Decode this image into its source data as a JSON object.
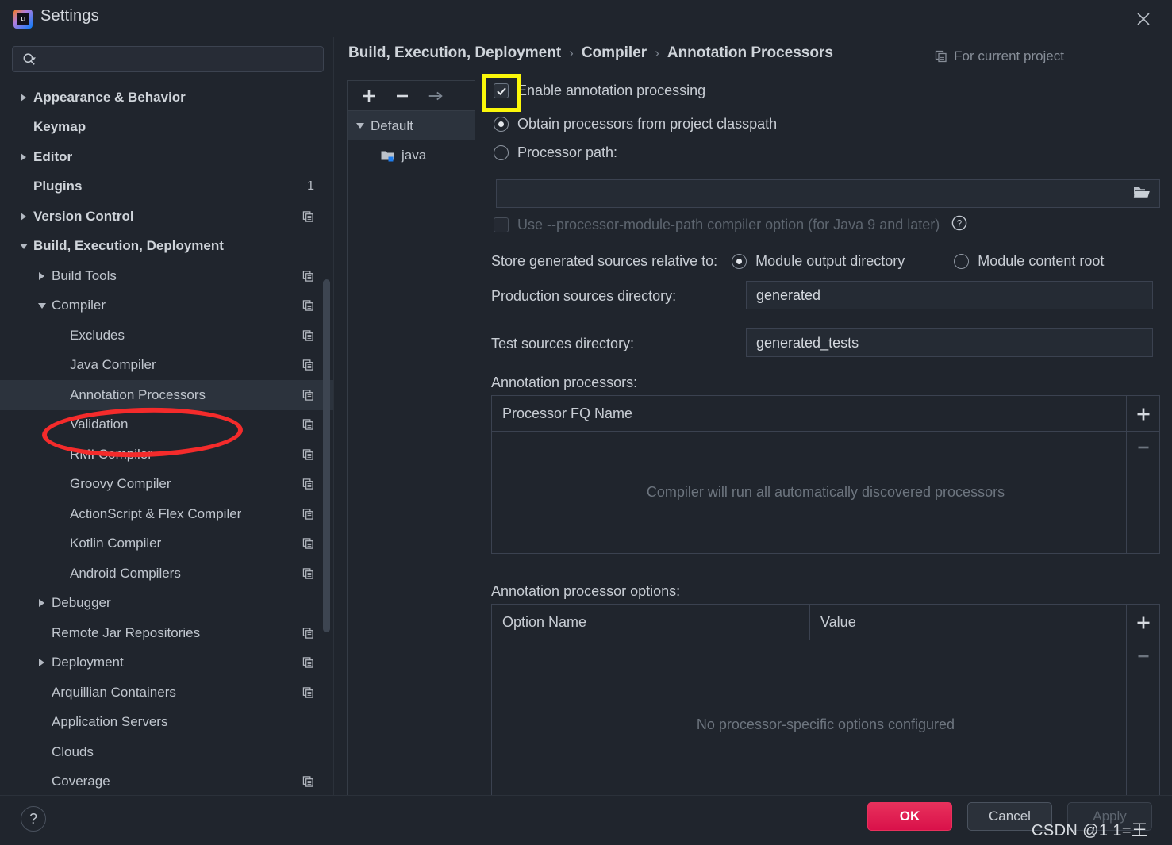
{
  "window": {
    "title": "Settings",
    "logo_text": "IJ",
    "close_icon": "close-icon"
  },
  "search": {
    "placeholder": "",
    "value": "",
    "icon": "search-icon"
  },
  "sidebar": {
    "items": [
      {
        "label": "Appearance & Behavior",
        "level": 1,
        "arrow": "right",
        "bold": true,
        "badge": "",
        "selected": false
      },
      {
        "label": "Keymap",
        "level": 1,
        "arrow": "none",
        "bold": true,
        "badge": "",
        "selected": false
      },
      {
        "label": "Editor",
        "level": 1,
        "arrow": "right",
        "bold": true,
        "badge": "",
        "selected": false
      },
      {
        "label": "Plugins",
        "level": 1,
        "arrow": "none",
        "bold": true,
        "badge": "1",
        "selected": false
      },
      {
        "label": "Version Control",
        "level": 1,
        "arrow": "right",
        "bold": true,
        "badge": "copy",
        "selected": false
      },
      {
        "label": "Build, Execution, Deployment",
        "level": 1,
        "arrow": "down",
        "bold": true,
        "badge": "",
        "selected": false
      },
      {
        "label": "Build Tools",
        "level": 2,
        "arrow": "right",
        "bold": false,
        "badge": "copy",
        "selected": false
      },
      {
        "label": "Compiler",
        "level": 2,
        "arrow": "down",
        "bold": false,
        "badge": "copy",
        "selected": false
      },
      {
        "label": "Excludes",
        "level": 3,
        "arrow": "none",
        "bold": false,
        "badge": "copy",
        "selected": false
      },
      {
        "label": "Java Compiler",
        "level": 3,
        "arrow": "none",
        "bold": false,
        "badge": "copy",
        "selected": false
      },
      {
        "label": "Annotation Processors",
        "level": 3,
        "arrow": "none",
        "bold": false,
        "badge": "copy",
        "selected": true
      },
      {
        "label": "Validation",
        "level": 3,
        "arrow": "none",
        "bold": false,
        "badge": "copy",
        "selected": false
      },
      {
        "label": "RMI Compiler",
        "level": 3,
        "arrow": "none",
        "bold": false,
        "badge": "copy",
        "selected": false
      },
      {
        "label": "Groovy Compiler",
        "level": 3,
        "arrow": "none",
        "bold": false,
        "badge": "copy",
        "selected": false
      },
      {
        "label": "ActionScript & Flex Compiler",
        "level": 3,
        "arrow": "none",
        "bold": false,
        "badge": "copy",
        "selected": false
      },
      {
        "label": "Kotlin Compiler",
        "level": 3,
        "arrow": "none",
        "bold": false,
        "badge": "copy",
        "selected": false
      },
      {
        "label": "Android Compilers",
        "level": 3,
        "arrow": "none",
        "bold": false,
        "badge": "copy",
        "selected": false
      },
      {
        "label": "Debugger",
        "level": 2,
        "arrow": "right",
        "bold": false,
        "badge": "",
        "selected": false
      },
      {
        "label": "Remote Jar Repositories",
        "level": 2,
        "arrow": "none",
        "bold": false,
        "badge": "copy",
        "selected": false
      },
      {
        "label": "Deployment",
        "level": 2,
        "arrow": "right",
        "bold": false,
        "badge": "copy",
        "selected": false
      },
      {
        "label": "Arquillian Containers",
        "level": 2,
        "arrow": "none",
        "bold": false,
        "badge": "copy",
        "selected": false
      },
      {
        "label": "Application Servers",
        "level": 2,
        "arrow": "none",
        "bold": false,
        "badge": "",
        "selected": false
      },
      {
        "label": "Clouds",
        "level": 2,
        "arrow": "none",
        "bold": false,
        "badge": "",
        "selected": false
      },
      {
        "label": "Coverage",
        "level": 2,
        "arrow": "none",
        "bold": false,
        "badge": "copy",
        "selected": false
      }
    ]
  },
  "breadcrumb": {
    "items": [
      "Build, Execution, Deployment",
      "Compiler",
      "Annotation Processors"
    ],
    "separator": "›"
  },
  "scope": {
    "label": "For current project",
    "icon": "copy-icon"
  },
  "profiles": {
    "toolbar": {
      "add_label": "+",
      "remove_label": "−",
      "move_label": "→"
    },
    "root": {
      "label": "Default",
      "expanded": true
    },
    "children": [
      {
        "label": "java",
        "icon": "module-folder-icon"
      }
    ]
  },
  "form": {
    "enable_annotation_processing": {
      "label": "Enable annotation processing",
      "checked": true,
      "highlighted": true
    },
    "source_mode": {
      "options": [
        {
          "label": "Obtain processors from project classpath",
          "selected": true
        },
        {
          "label": "Processor path:",
          "selected": false
        }
      ]
    },
    "processor_path": {
      "value": "",
      "browse_icon": "folder-open-icon"
    },
    "module_path_option": {
      "label": "Use --processor-module-path compiler option (for Java 9 and later)",
      "checked": false,
      "disabled": true,
      "help_icon": "help-circle-icon"
    },
    "store_generated": {
      "label": "Store generated sources relative to:",
      "options": [
        {
          "label": "Module output directory",
          "selected": true
        },
        {
          "label": "Module content root",
          "selected": false
        }
      ]
    },
    "production_sources": {
      "label": "Production sources directory:",
      "value": "generated"
    },
    "test_sources": {
      "label": "Test sources directory:",
      "value": "generated_tests"
    },
    "processors_table": {
      "label": "Annotation processors:",
      "columns": [
        "Processor FQ Name"
      ],
      "rows": [],
      "empty_text": "Compiler will run all automatically discovered processors",
      "add_label": "+",
      "remove_label": "−"
    },
    "options_table": {
      "label": "Annotation processor options:",
      "columns": [
        "Option Name",
        "Value"
      ],
      "rows": [],
      "empty_text": "No processor-specific options configured",
      "add_label": "+",
      "remove_label": "−"
    }
  },
  "footer": {
    "help_label": "?",
    "ok_label": "OK",
    "cancel_label": "Cancel",
    "apply_label": "Apply",
    "apply_disabled": true
  },
  "watermark": {
    "text": "CSDN @1 1=王"
  },
  "colors": {
    "background": "#20252d",
    "panel": "#20252d",
    "selected_row": "#2c333d",
    "accent_ok": "#e8315c",
    "annotation_ellipse": "#f42b2b",
    "annotation_highlight": "#fbf70a",
    "border": "#3b4250"
  }
}
